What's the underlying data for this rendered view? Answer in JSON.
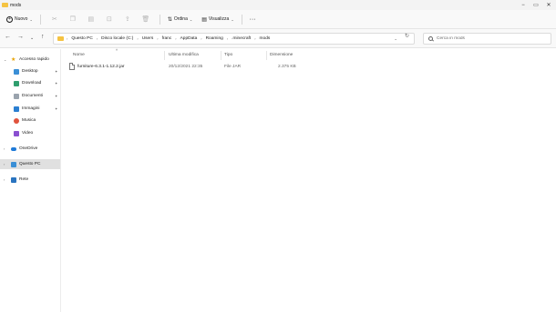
{
  "window": {
    "title": "mods"
  },
  "toolbar": {
    "new_label": "Nuovo",
    "sort_label": "Ordina",
    "view_label": "Visualizza",
    "more_label": "···"
  },
  "address": {
    "crumbs": [
      "Questo PC",
      "Disco locale (C:)",
      "Users",
      "franc",
      "AppData",
      "Roaming",
      ".minecraft",
      "mods"
    ]
  },
  "search": {
    "placeholder": "Cerca in mods"
  },
  "sidebar": {
    "items": [
      {
        "label": "Accesso rapido",
        "icon": "star-icon"
      },
      {
        "label": "Desktop",
        "icon": "desktop-icon"
      },
      {
        "label": "Download",
        "icon": "download-icon"
      },
      {
        "label": "Documenti",
        "icon": "documents-icon"
      },
      {
        "label": "Immagini",
        "icon": "pictures-icon"
      },
      {
        "label": "Musica",
        "icon": "music-icon"
      },
      {
        "label": "Video",
        "icon": "video-icon"
      },
      {
        "label": "OneDrive",
        "icon": "cloud-icon"
      },
      {
        "label": "Questo PC",
        "icon": "computer-icon"
      },
      {
        "label": "Rete",
        "icon": "network-icon"
      }
    ]
  },
  "columns": [
    "Nome",
    "Ultima modifica",
    "Tipo",
    "Dimensione"
  ],
  "files": [
    {
      "name": "furniture-6.3.1-1.12.2.jar",
      "modified": "20/12/2021 22:35",
      "type": "File JAR",
      "size": "2.375 KB"
    }
  ],
  "colors": {
    "accent": "#0067c0",
    "folder": "#f5c342",
    "selected": "#e0e0e0"
  }
}
